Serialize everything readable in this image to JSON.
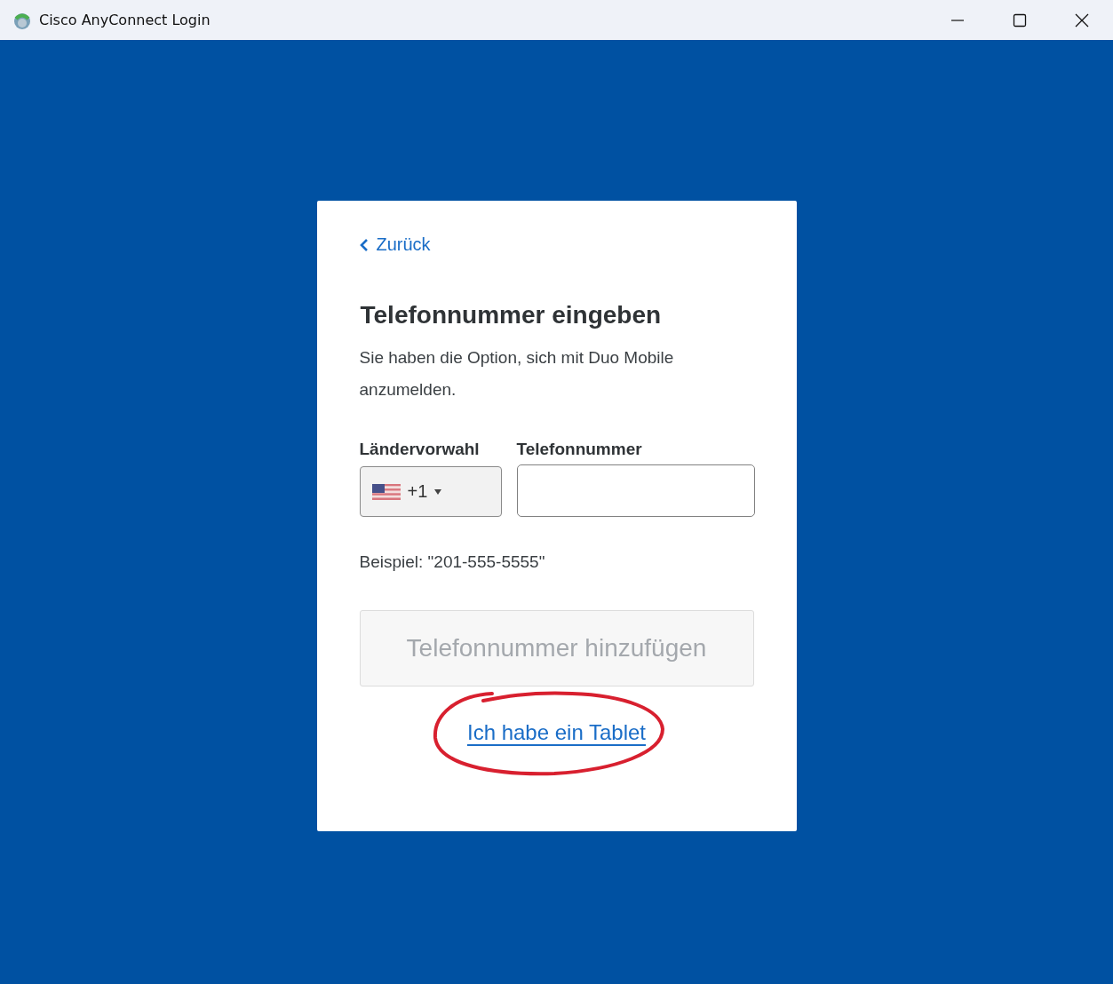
{
  "window": {
    "title": "Cisco AnyConnect Login"
  },
  "back_link": {
    "label": "Zurück"
  },
  "heading": "Telefonnummer eingeben",
  "description": "Sie haben die Option, sich mit Duo Mobile anzumelden.",
  "country_code": {
    "label": "Ländervorwahl",
    "value": "+1"
  },
  "phone": {
    "label": "Telefonnummer"
  },
  "example": "Beispiel: \"201-555-5555\"",
  "add_button": {
    "label": "Telefonnummer hinzufügen",
    "disabled": true
  },
  "tablet_link": {
    "label": "Ich habe ein Tablet",
    "circled": true
  }
}
